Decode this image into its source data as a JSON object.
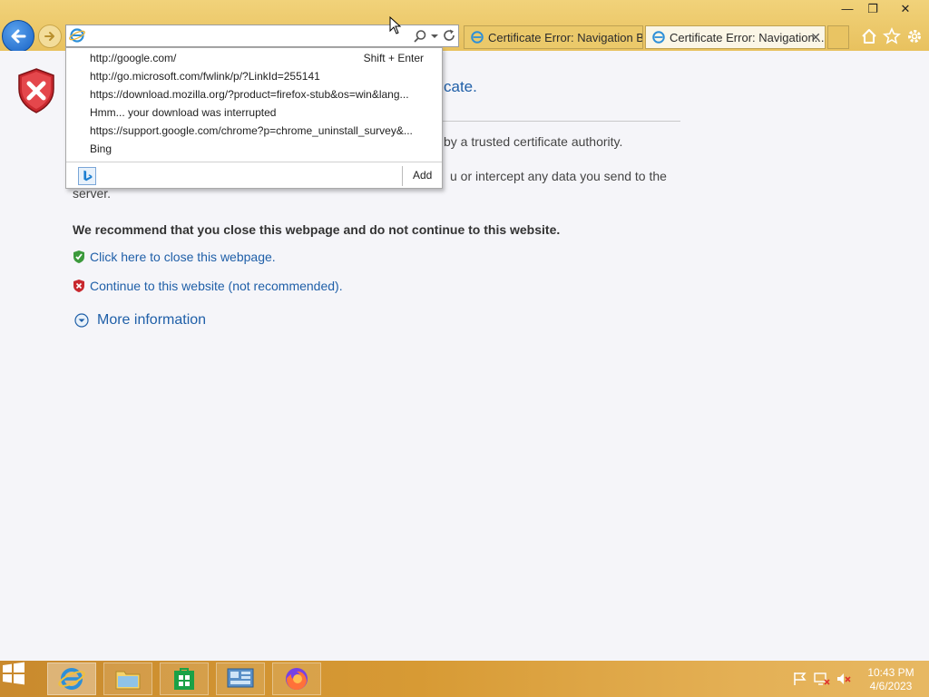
{
  "window": {
    "min_symbol": "—",
    "max_symbol": "❐",
    "close_symbol": "✕"
  },
  "address_bar": {
    "value": "",
    "placeholder": ""
  },
  "tabs": [
    {
      "label": "Certificate Error: Navigation Bl..."
    },
    {
      "label": "Certificate Error: Navigation...",
      "close": "✕"
    }
  ],
  "dropdown": {
    "items": [
      "http://google.com/",
      "http://go.microsoft.com/fwlink/p/?LinkId=255141",
      "https://download.mozilla.org/?product=firefox-stub&os=win&lang...",
      "Hmm... your download was interrupted",
      "https://support.google.com/chrome?p=chrome_uninstall_survey&...",
      "Bing"
    ],
    "shortcut": "Shift + Enter",
    "add_label": "Add"
  },
  "page": {
    "title_tail": "cate.",
    "para1_tail": "by a trusted certificate authority.",
    "para2_tail": "u or intercept any data you send to the",
    "para2_wrap": "server.",
    "recommend": "We recommend that you close this webpage and do not continue to this website.",
    "close_link": "Click here to close this webpage.",
    "continue_link": "Continue to this website (not recommended).",
    "more_info": "More information"
  },
  "taskbar": {
    "clock_time": "10:43 PM",
    "clock_date": "4/6/2023"
  },
  "colors": {
    "accent_link": "#1f5fa8",
    "titlebar": "#e8c15e",
    "taskbar": "#d79a34"
  }
}
